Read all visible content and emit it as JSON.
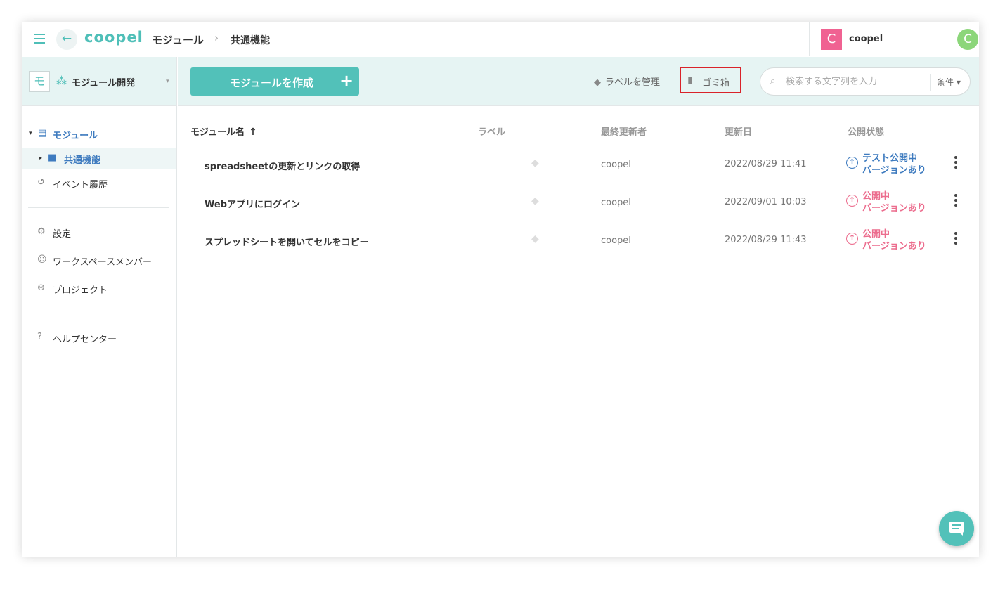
{
  "header": {
    "logo": "coopel",
    "breadcrumb": [
      "モジュール",
      "共通機能"
    ],
    "breadcrumb_sep": "›",
    "workspace_avatar": "C",
    "workspace_name": "coopel",
    "user_avatar": "C"
  },
  "sidebar": {
    "project_initial": "モ",
    "project_name": "モジュール開発",
    "items": [
      {
        "label": "モジュール"
      },
      {
        "label": "共通機能"
      },
      {
        "label": "イベント履歴"
      },
      {
        "label": "設定"
      },
      {
        "label": "ワークスペースメンバー"
      },
      {
        "label": "プロジェクト"
      },
      {
        "label": "ヘルプセンター"
      }
    ]
  },
  "toolbar": {
    "create_label": "モジュールを作成",
    "create_plus": "+",
    "label_manage": "ラベルを管理",
    "trash": "ゴミ箱",
    "search_placeholder": "検索する文字列を入力",
    "search_value": "",
    "condition": "条件 ▾"
  },
  "table": {
    "columns": [
      "モジュール名",
      "ラベル",
      "最終更新者",
      "更新日",
      "公開状態"
    ],
    "sort_indicator": "↑",
    "rows": [
      {
        "name": "spreadsheetの更新とリンクの取得",
        "updater": "coopel",
        "date": "2022/08/29 11:41",
        "status_line1": "テスト公開中",
        "status_line2": "バージョンあり",
        "status_color": "#3e7bbf"
      },
      {
        "name": "Webアプリにログイン",
        "updater": "coopel",
        "date": "2022/09/01 10:03",
        "status_line1": "公開中",
        "status_line2": "バージョンあり",
        "status_color": "#ec6d8e"
      },
      {
        "name": "スプレッドシートを開いてセルをコピー",
        "updater": "coopel",
        "date": "2022/08/29 11:43",
        "status_line1": "公開中",
        "status_line2": "バージョンあり",
        "status_color": "#ec6d8e"
      }
    ]
  },
  "colors": {
    "accent": "#52c1b9",
    "link": "#3e7bbf",
    "published": "#ec6d8e",
    "highlight_border": "#d9232a"
  },
  "icons": [
    "hamburger-icon",
    "back-arrow-icon",
    "tag-icon",
    "trash-icon",
    "search-icon",
    "chat-icon",
    "kebab-menu-icon"
  ]
}
